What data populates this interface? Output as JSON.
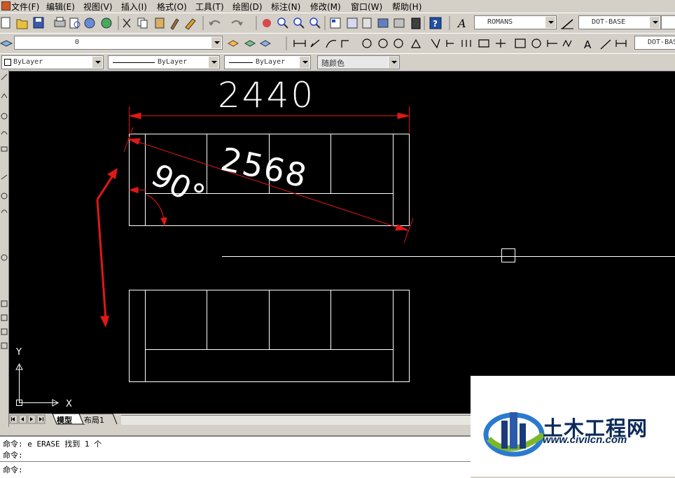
{
  "menubar": {
    "items": [
      "文件(F)",
      "编辑(E)",
      "视图(V)",
      "插入(I)",
      "格式(O)",
      "工具(T)",
      "绘图(D)",
      "标注(N)",
      "修改(M)",
      "窗口(W)",
      "帮助(H)"
    ]
  },
  "toolbar": {
    "text_style": "ROMANS",
    "dim_style": "DOT-BASE",
    "dim_style_2": "DOT-BASE",
    "layer_current": "0"
  },
  "properties": {
    "color": "ByLayer",
    "linetype": "ByLayer",
    "lineweight": "ByLayer",
    "plotstyle": "随颜色"
  },
  "drawing": {
    "dim_width": "2440",
    "dim_diagonal": "2568",
    "dim_angle": "90°",
    "ucs_x": "X",
    "ucs_y": "Y",
    "annotation_color": "#e01818",
    "line_color": "#ffffff"
  },
  "tabs": {
    "model": "模型",
    "layout1": "布局1"
  },
  "command_line": {
    "line1": "命令: e ERASE 找到 1 个",
    "line2": "命令:",
    "line3": "命令:"
  },
  "watermark": {
    "title": "土木工程网",
    "url": "www.civilcn.com"
  }
}
